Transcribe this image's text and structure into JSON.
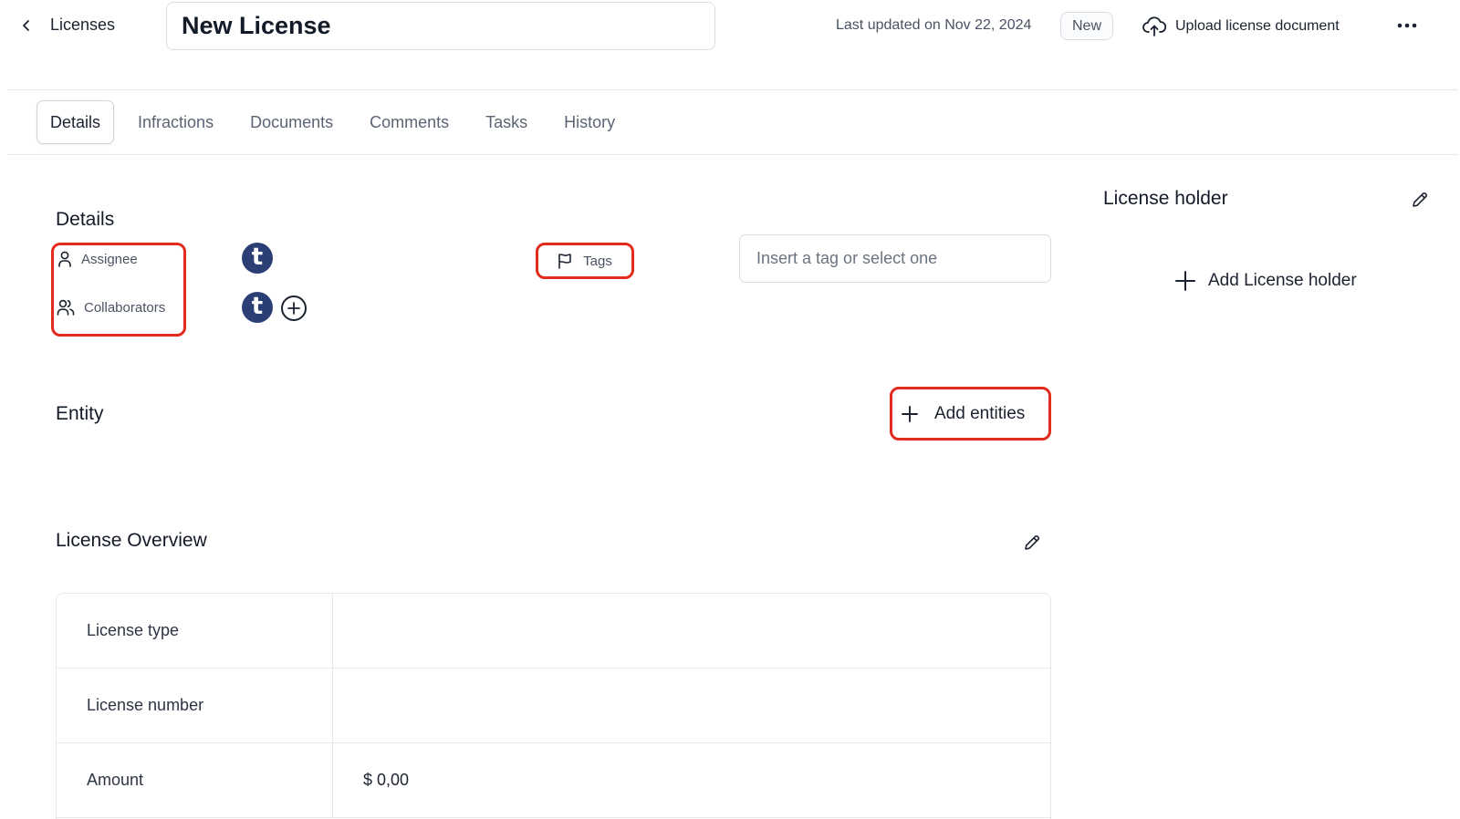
{
  "header": {
    "breadcrumb": "Licenses",
    "title": "New License",
    "last_updated": "Last updated on Nov 22, 2024",
    "status_badge": "New",
    "upload_label": "Upload license document"
  },
  "tabs": [
    {
      "label": "Details",
      "active": true
    },
    {
      "label": "Infractions"
    },
    {
      "label": "Documents"
    },
    {
      "label": "Comments"
    },
    {
      "label": "Tasks"
    },
    {
      "label": "History"
    }
  ],
  "details": {
    "heading": "Details",
    "assignee_label": "Assignee",
    "collaborators_label": "Collaborators",
    "avatar_initial": "t",
    "tags_label": "Tags",
    "tag_placeholder": "Insert a tag or select one"
  },
  "entity": {
    "heading": "Entity",
    "add_label": "Add entities"
  },
  "overview": {
    "heading": "License Overview",
    "rows": [
      {
        "label": "License type",
        "value": ""
      },
      {
        "label": "License number",
        "value": ""
      },
      {
        "label": "Amount",
        "value": "$ 0,00"
      }
    ]
  },
  "holder": {
    "heading": "License holder",
    "add_label": "Add License holder"
  },
  "colors": {
    "highlight": "#e32b1d",
    "avatar": "#2b3f75"
  }
}
